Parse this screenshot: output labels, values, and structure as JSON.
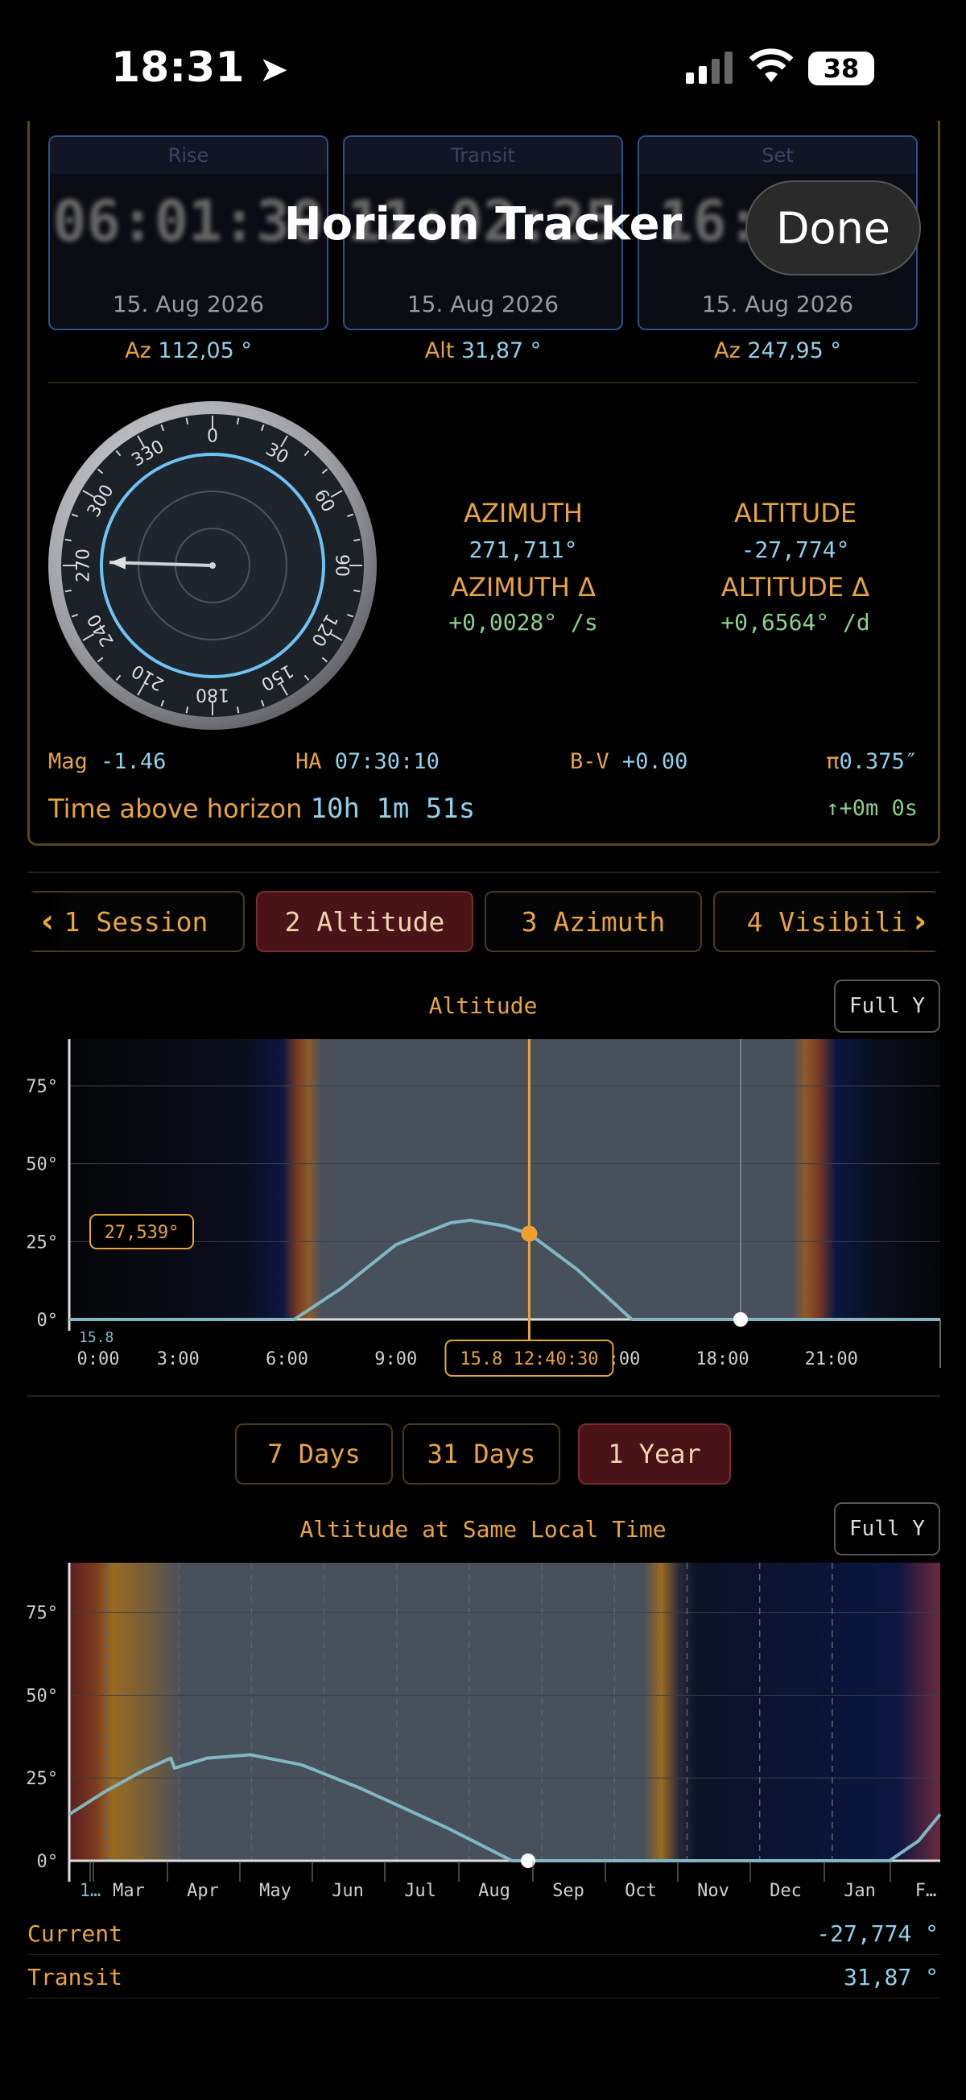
{
  "status_bar": {
    "time": "18:31",
    "battery": "38"
  },
  "header": {
    "title": "Horizon Tracker",
    "done_label": "Done"
  },
  "events": [
    {
      "head": "Rise",
      "time": "06:01:30",
      "date": "15. Aug 2026",
      "label": "Az",
      "value": "112,05 °"
    },
    {
      "head": "Transit",
      "time": "11:02:25",
      "date": "15. Aug 2026",
      "label": "Alt",
      "value": "31,87 °"
    },
    {
      "head": "Set",
      "time": "16:01:1",
      "date": "15. Aug 2026",
      "label": "Az",
      "value": "247,95 °"
    }
  ],
  "compass": {
    "labels": [
      "0",
      "30",
      "60",
      "90",
      "120",
      "150",
      "180",
      "210",
      "240",
      "270",
      "300",
      "330"
    ],
    "needle_azimuth": 271.711
  },
  "readout": {
    "azimuth_label": "AZIMUTH",
    "azimuth_value": "271,711°",
    "altitude_label": "ALTITUDE",
    "altitude_value": "-27,774°",
    "azimuth_delta_label": "AZIMUTH Δ",
    "azimuth_delta_value": "+0,0028° /s",
    "altitude_delta_label": "ALTITUDE Δ",
    "altitude_delta_value": "+0,6564° /d"
  },
  "stats": {
    "mag_label": "Mag",
    "mag_value": "-1.46",
    "ha_label": "HA",
    "ha_value": "07:30:10",
    "bv_label": "B-V",
    "bv_value": "+0.00",
    "pi_label": "π",
    "pi_value": "0.375″",
    "above_label": "Time above horizon",
    "above_value": "10h  1m 51s",
    "trend": "↑+0m 0s"
  },
  "tabs": [
    "1 Session",
    "2 Altitude",
    "3 Azimuth",
    "4 Visibili"
  ],
  "active_tab": 1,
  "altitude_chart": {
    "title": "Altitude",
    "full_y_label": "Full Y",
    "date_tag": "15.8",
    "cursor_label": "15.8 12:40:30",
    "cursor_value": "27,539°"
  },
  "range_buttons": [
    "7 Days",
    "31 Days",
    "1 Year"
  ],
  "active_range": 2,
  "year_chart": {
    "title": "Altitude at Same Local Time",
    "full_y_label": "Full Y",
    "first_tick": "1…",
    "last_tick": "F…"
  },
  "summary": [
    {
      "label": "Current",
      "value": "-27,774 °"
    },
    {
      "label": "Transit",
      "value": "31,87 °"
    }
  ],
  "colors": {
    "accent": "#e9a43c",
    "curve": "#7fb8c4",
    "active_tab": "#4a1318",
    "ring": "#6ec3f5"
  },
  "chart_data": [
    {
      "type": "line",
      "title": "Altitude",
      "x": [
        "0:00",
        "3:00",
        "6:00",
        "9:00",
        "12:00",
        "15:00",
        "18:00",
        "21:00"
      ],
      "xticks": [
        "0:00",
        "3:00",
        "6:00",
        "9:00",
        "15:00",
        "18:00",
        "21:00"
      ],
      "yticks": [
        "0°",
        "25°",
        "50°",
        "75°"
      ],
      "ylim": [
        0,
        90
      ],
      "xlim_hours": [
        0,
        24
      ],
      "series": [
        {
          "points": [
            [
              0,
              0
            ],
            [
              6,
              0
            ],
            [
              6.2,
              0
            ],
            [
              7.5,
              10
            ],
            [
              9,
              24
            ],
            [
              10.5,
              31
            ],
            [
              11.05,
              31.87
            ],
            [
              12,
              30
            ],
            [
              12.67,
              27.54
            ],
            [
              14,
              16
            ],
            [
              15.5,
              0
            ],
            [
              24,
              0
            ]
          ]
        }
      ],
      "cursor": {
        "x_hours": 12.675,
        "y": 27.539
      },
      "marker_x_hours": 18.5,
      "grid": true
    },
    {
      "type": "line",
      "title": "Altitude at Same Local Time",
      "xticks": [
        "1…",
        "Mar",
        "Apr",
        "May",
        "Jun",
        "Jul",
        "Aug",
        "Sep",
        "Oct",
        "Nov",
        "Dec",
        "Jan",
        "F…"
      ],
      "yticks": [
        "0°",
        "25°",
        "50°",
        "75°"
      ],
      "ylim": [
        0,
        90
      ],
      "series": [
        {
          "points": [
            [
              0,
              14
            ],
            [
              0.5,
              21
            ],
            [
              1,
              27
            ],
            [
              1.4,
              31
            ],
            [
              1.45,
              28
            ],
            [
              1.9,
              31
            ],
            [
              2.5,
              32
            ],
            [
              3.2,
              29
            ],
            [
              4,
              22
            ],
            [
              5.2,
              10
            ],
            [
              6.1,
              0
            ],
            [
              11.3,
              0
            ],
            [
              11.7,
              6
            ],
            [
              12,
              14
            ]
          ]
        }
      ],
      "marker_x_month": 6.1,
      "grid": true
    }
  ]
}
